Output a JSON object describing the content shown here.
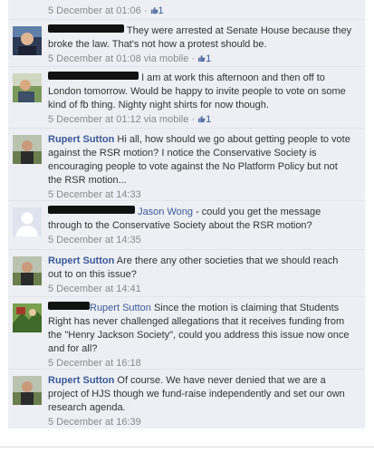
{
  "comments": [
    {
      "author": "",
      "text": "",
      "time": "5 December at 01:06",
      "like_count": "1",
      "dot": "·"
    },
    {
      "author": "",
      "text": "They were arrested at Senate House because they broke the law. That's not how a protest should be.",
      "time": "5 December at 01:08",
      "via": "via mobile",
      "like_count": "1",
      "dot": "·"
    },
    {
      "author": "",
      "text": "I am at work this afternoon and then off to London tomorrow. Would be happy to invite people to vote on some kind of fb thing. Nighty night shirts for now though.",
      "time": "5 December at 01:12",
      "via": "via mobile",
      "like_count": "1",
      "dot": "·"
    },
    {
      "author": "Rupert Sutton",
      "text": "Hi all, how should we go about getting people to vote against the RSR motion? I notice the Conservative Society is encouraging people to vote against the No Platform Policy but not the RSR motion...",
      "time": "5 December at 14:33"
    },
    {
      "author": "Jason Wong",
      "text": "- could you get the message through to the Conservative Society about the RSR motion?",
      "time": "5 December at 14:35"
    },
    {
      "author": "Rupert Sutton",
      "text": "Are there any other societies that we should reach out to on this issue?",
      "time": "5 December at 14:41"
    },
    {
      "author": "Rupert Sutton",
      "text": "Since the motion is claiming that Students Right has never challenged allegations that it receives funding from the \"Henry Jackson Society\", could you address this issue now once and for all?",
      "time": "5 December at 16:18"
    },
    {
      "author": "Rupert Sutton",
      "text": "Of course. We have never denied that we are a project of HJS though we fund-raise independently and set our own research agenda.",
      "time": "5 December at 16:39"
    }
  ]
}
